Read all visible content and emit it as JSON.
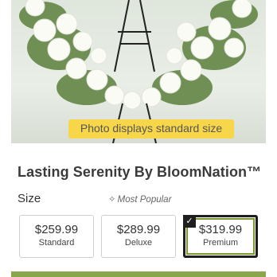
{
  "product": {
    "photo_caption": "Photo displays standard size",
    "title": "Lasting Serenity By BloomNation™"
  },
  "size_selector": {
    "label": "Size",
    "popular_icon": "sparkle-icon",
    "popular_text": "Most Popular",
    "options": [
      {
        "price": "$259.99",
        "tier": "Standard",
        "selected": false
      },
      {
        "price": "$289.99",
        "tier": "Deluxe",
        "selected": false
      },
      {
        "price": "$319.99",
        "tier": "Premium",
        "selected": true
      }
    ]
  },
  "colors": {
    "accent_green": "#8aa64a",
    "caption_yellow": "#f7d64a",
    "selected_border": "#1e1e1e"
  }
}
